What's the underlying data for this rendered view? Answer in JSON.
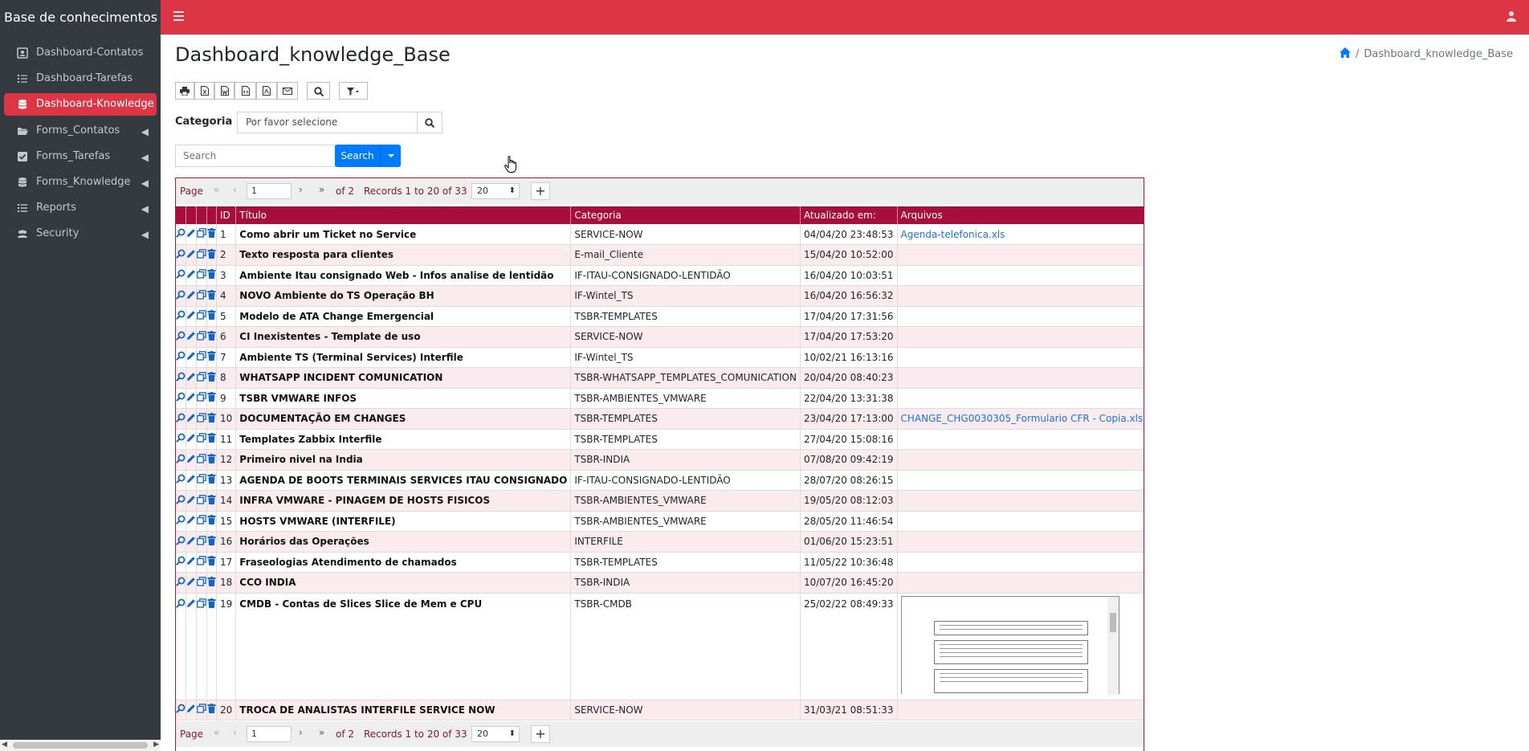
{
  "app": {
    "brand": "Base de conhecimentos PHP"
  },
  "colors": {
    "topbar": "#dc3545",
    "sidebar": "#343a40",
    "header_row": "#a80e3d",
    "link": "#1a73e8"
  },
  "sidebar": {
    "items": [
      {
        "label": "Dashboard-Contatos",
        "icon": "address-card-icon"
      },
      {
        "label": "Dashboard-Tarefas",
        "icon": "tasks-icon"
      },
      {
        "label": "Dashboard-Knowledge",
        "icon": "database-icon",
        "active": true
      },
      {
        "label": "Forms_Contatos",
        "icon": "folder-open-icon",
        "expandable": true
      },
      {
        "label": "Forms_Tarefas",
        "icon": "check-square-icon",
        "expandable": true
      },
      {
        "label": "Forms_Knowledge",
        "icon": "database-icon",
        "expandable": true
      },
      {
        "label": "Reports",
        "icon": "list-icon",
        "expandable": true
      },
      {
        "label": "Security",
        "icon": "users-icon",
        "expandable": true
      }
    ]
  },
  "header": {
    "title": "Dashboard_knowledge_Base",
    "breadcrumb": {
      "separator": "/",
      "current": "Dashboard_knowledge_Base"
    }
  },
  "toolbar": {
    "buttons": [
      "print-icon",
      "excel-icon",
      "word-icon",
      "xml-icon",
      "pdf-icon",
      "email-icon",
      "search-icon",
      "filter-icon"
    ]
  },
  "filter": {
    "label": "Categoria",
    "placeholder": "Por favor selecione"
  },
  "search": {
    "placeholder": "Search",
    "button": "Search"
  },
  "pager": {
    "page_label": "Page",
    "page": "1",
    "of": "of 2",
    "records": "Records 1 to 20 of 33",
    "page_size": "20"
  },
  "grid": {
    "columns": [
      "ID",
      "Título",
      "Categoria",
      "Atualizado em:",
      "Arquivos"
    ],
    "rows": [
      {
        "id": "1",
        "titulo": "Como abrir um Ticket no Service",
        "categoria": "SERVICE-NOW",
        "data": "04/04/20 23:48:53",
        "arquivo": "Agenda-telefonica.xls"
      },
      {
        "id": "2",
        "titulo": "Texto resposta para clientes",
        "categoria": "E-mail_Cliente",
        "data": "15/04/20 10:52:00",
        "arquivo": ""
      },
      {
        "id": "3",
        "titulo": "Ambiente Itau consignado Web - Infos analise de lentidão",
        "categoria": "IF-ITAU-CONSIGNADO-LENTIDÃO",
        "data": "16/04/20 10:03:51",
        "arquivo": ""
      },
      {
        "id": "4",
        "titulo": "NOVO Ambiente do TS Operação BH",
        "categoria": "IF-Wintel_TS",
        "data": "16/04/20 16:56:32",
        "arquivo": ""
      },
      {
        "id": "5",
        "titulo": "Modelo de ATA Change Emergencial",
        "categoria": "TSBR-TEMPLATES",
        "data": "17/04/20 17:31:56",
        "arquivo": ""
      },
      {
        "id": "6",
        "titulo": "CI Inexistentes - Template de uso",
        "categoria": "SERVICE-NOW",
        "data": "17/04/20 17:53:20",
        "arquivo": ""
      },
      {
        "id": "7",
        "titulo": "Ambiente TS (Terminal Services) Interfile",
        "categoria": "IF-Wintel_TS",
        "data": "10/02/21 16:13:16",
        "arquivo": ""
      },
      {
        "id": "8",
        "titulo": "WHATSAPP INCIDENT COMUNICATION",
        "categoria": "TSBR-WHATSAPP_TEMPLATES_COMUNICATION",
        "data": "20/04/20 08:40:23",
        "arquivo": ""
      },
      {
        "id": "9",
        "titulo": "TSBR VMWARE INFOS",
        "categoria": "TSBR-AMBIENTES_VMWARE",
        "data": "22/04/20 13:31:38",
        "arquivo": ""
      },
      {
        "id": "10",
        "titulo": "DOCUMENTAÇÃO EM CHANGES",
        "categoria": "TSBR-TEMPLATES",
        "data": "23/04/20 17:13:00",
        "arquivo": "CHANGE_CHG0030305_Formulario CFR - Copia.xls"
      },
      {
        "id": "11",
        "titulo": "Templates Zabbix Interfile",
        "categoria": "TSBR-TEMPLATES",
        "data": "27/04/20 15:08:16",
        "arquivo": ""
      },
      {
        "id": "12",
        "titulo": "Primeiro nivel na India",
        "categoria": "TSBR-INDIA",
        "data": "07/08/20 09:42:19",
        "arquivo": ""
      },
      {
        "id": "13",
        "titulo": "AGENDA DE BOOTS TERMINAIS SERVICES ITAU CONSIGNADO",
        "categoria": "IF-ITAU-CONSIGNADO-LENTIDÃO",
        "data": "28/07/20 08:26:15",
        "arquivo": ""
      },
      {
        "id": "14",
        "titulo": "INFRA VMWARE - PINAGEM DE HOSTS FISICOS",
        "categoria": "TSBR-AMBIENTES_VMWARE",
        "data": "19/05/20 08:12:03",
        "arquivo": ""
      },
      {
        "id": "15",
        "titulo": "HOSTS VMWARE (INTERFILE)",
        "categoria": "TSBR-AMBIENTES_VMWARE",
        "data": "28/05/20 11:46:54",
        "arquivo": ""
      },
      {
        "id": "16",
        "titulo": "Horários das Operações",
        "categoria": "INTERFILE",
        "data": "01/06/20 15:23:51",
        "arquivo": ""
      },
      {
        "id": "17",
        "titulo": "Fraseologias Atendimento de chamados",
        "categoria": "TSBR-TEMPLATES",
        "data": "11/05/22 10:36:48",
        "arquivo": ""
      },
      {
        "id": "18",
        "titulo": "CCO INDIA",
        "categoria": "TSBR-INDIA",
        "data": "10/07/20 16:45:20",
        "arquivo": ""
      },
      {
        "id": "19",
        "titulo": "CMDB - Contas de Slices Slice de Mem e CPU",
        "categoria": "TSBR-CMDB",
        "data": "25/02/22 08:49:33",
        "arquivo": "",
        "preview": true
      },
      {
        "id": "20",
        "titulo": "TROCA DE ANALISTAS INTERFILE SERVICE NOW",
        "categoria": "SERVICE-NOW",
        "data": "31/03/21 08:51:33",
        "arquivo": ""
      }
    ]
  }
}
